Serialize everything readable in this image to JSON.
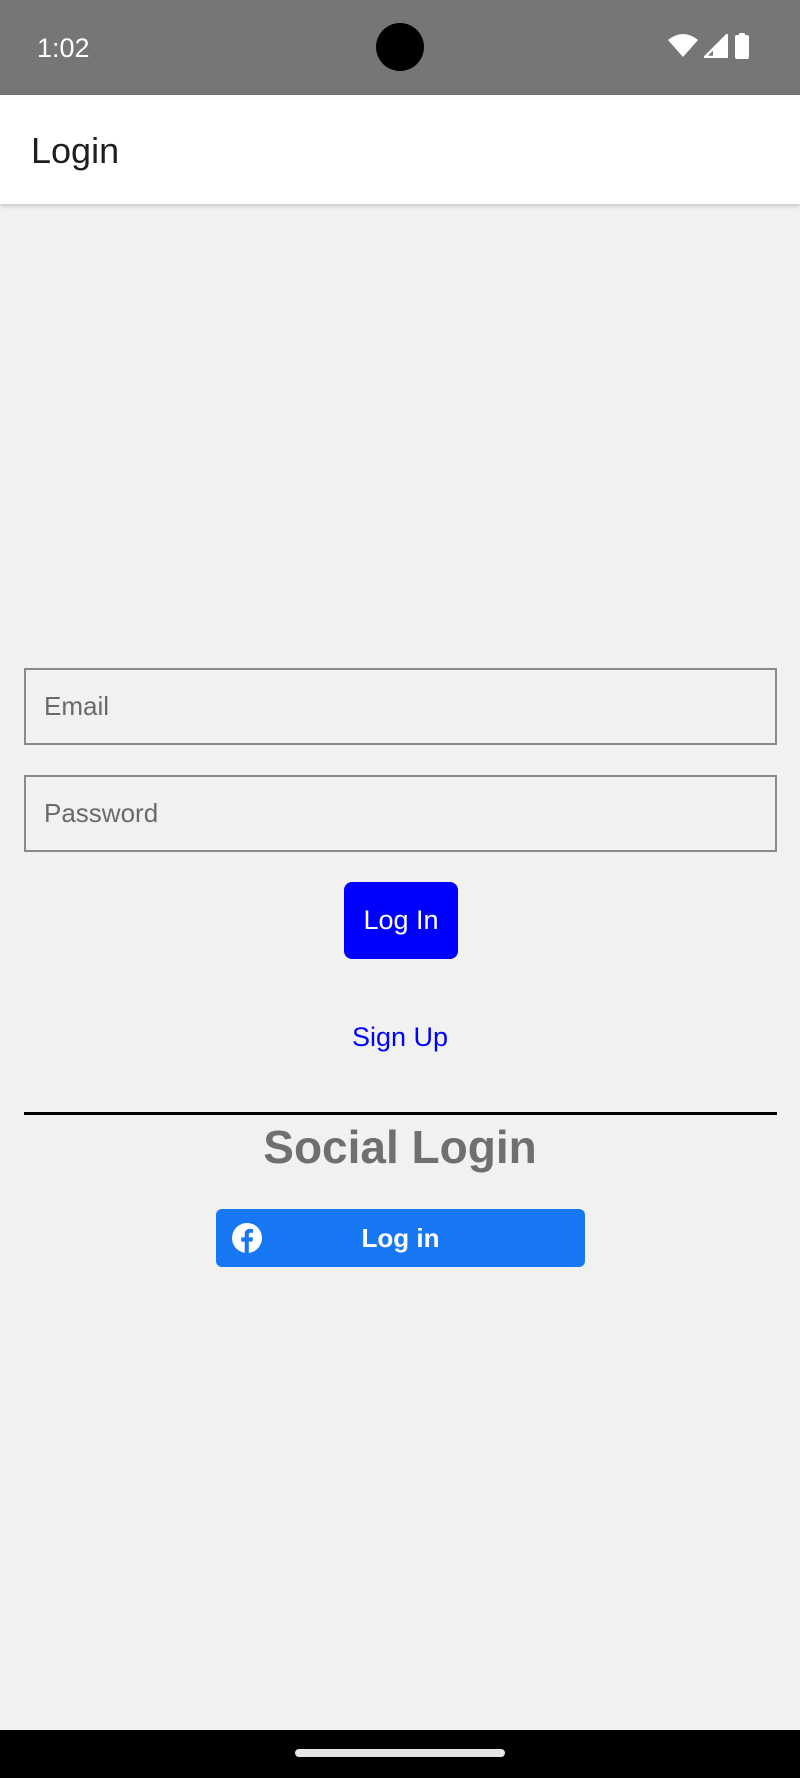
{
  "status_bar": {
    "time": "1:02",
    "icons": [
      "wifi-icon",
      "signal-icon",
      "battery-icon"
    ]
  },
  "app_bar": {
    "title": "Login"
  },
  "form": {
    "email_placeholder": "Email",
    "email_value": "",
    "password_placeholder": "Password",
    "password_value": "",
    "login_label": "Log In",
    "signup_label": "Sign Up"
  },
  "social": {
    "heading": "Social Login",
    "facebook_label": "Log in",
    "facebook_icon": "facebook-icon"
  },
  "colors": {
    "status_bar": "#767676",
    "primary_button": "#0000ff",
    "link": "#0000ff",
    "facebook": "#1877f2",
    "background": "#f1f1f1"
  }
}
